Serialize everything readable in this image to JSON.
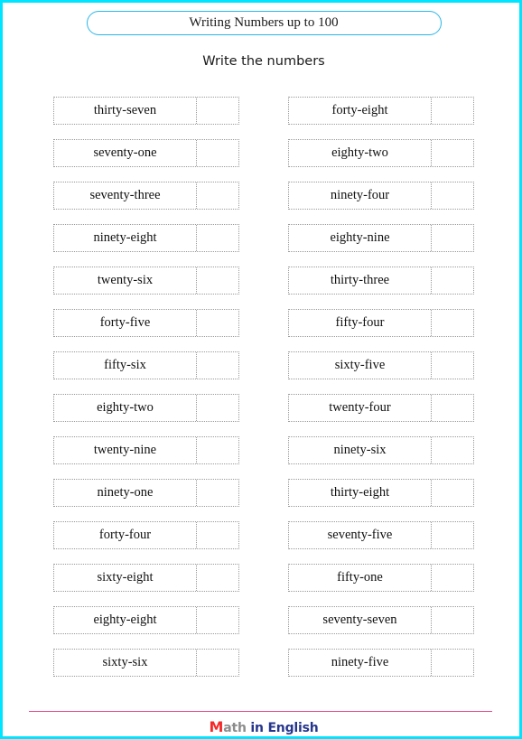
{
  "page": {
    "border_color": "#00e5ff",
    "background": "#ffffff"
  },
  "header": {
    "title": "Writing Numbers up to 100",
    "title_border_color": "#29b6e8",
    "subtitle": "Write the numbers"
  },
  "worksheet": {
    "left_column": [
      {
        "word": "thirty-seven",
        "answer": ""
      },
      {
        "word": "seventy-one",
        "answer": ""
      },
      {
        "word": "seventy-three",
        "answer": ""
      },
      {
        "word": "ninety-eight",
        "answer": ""
      },
      {
        "word": "twenty-six",
        "answer": ""
      },
      {
        "word": "forty-five",
        "answer": ""
      },
      {
        "word": "fifty-six",
        "answer": ""
      },
      {
        "word": "eighty-two",
        "answer": ""
      },
      {
        "word": "twenty-nine",
        "answer": ""
      },
      {
        "word": "ninety-one",
        "answer": ""
      },
      {
        "word": "forty-four",
        "answer": ""
      },
      {
        "word": "sixty-eight",
        "answer": ""
      },
      {
        "word": "eighty-eight",
        "answer": ""
      },
      {
        "word": "sixty-six",
        "answer": ""
      }
    ],
    "right_column": [
      {
        "word": "forty-eight",
        "answer": ""
      },
      {
        "word": "eighty-two",
        "answer": ""
      },
      {
        "word": "ninety-four",
        "answer": ""
      },
      {
        "word": "eighty-nine",
        "answer": ""
      },
      {
        "word": "thirty-three",
        "answer": ""
      },
      {
        "word": "fifty-four",
        "answer": ""
      },
      {
        "word": "sixty-five",
        "answer": ""
      },
      {
        "word": "twenty-four",
        "answer": ""
      },
      {
        "word": "ninety-six",
        "answer": ""
      },
      {
        "word": "thirty-eight",
        "answer": ""
      },
      {
        "word": "seventy-five",
        "answer": ""
      },
      {
        "word": "fifty-one",
        "answer": ""
      },
      {
        "word": "seventy-seven",
        "answer": ""
      },
      {
        "word": "ninety-five",
        "answer": ""
      }
    ]
  },
  "footer": {
    "rule_color": "#e8538f",
    "logo_m": "M",
    "logo_ath": "ath",
    "logo_rest": " in English",
    "logo_m_color": "#f42a2a",
    "logo_ath_color": "#8c8c8c",
    "logo_rest_color": "#26368c"
  }
}
